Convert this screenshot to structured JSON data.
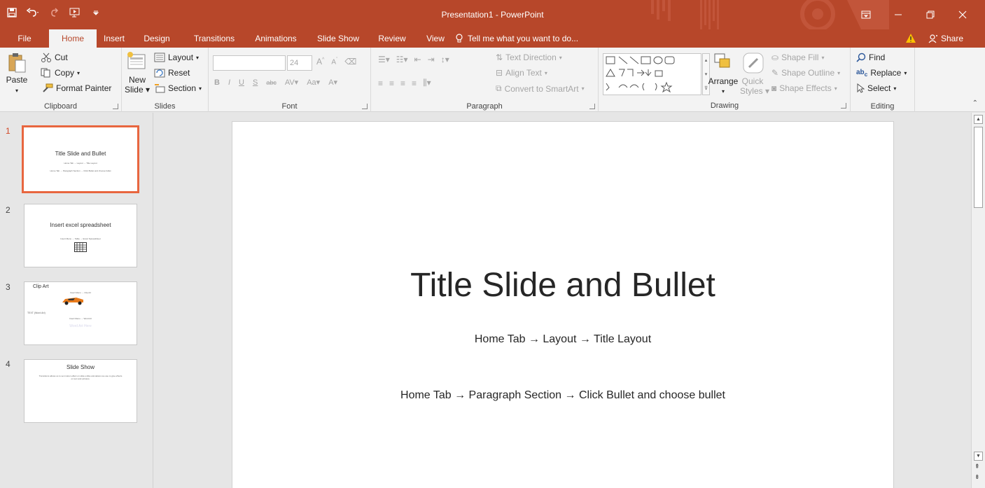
{
  "colors": {
    "accent": "#b7472a",
    "ribbon_bg": "#f3f3f3",
    "selected_thumb": "#e8663f"
  },
  "app": {
    "title": "Presentation1 - PowerPoint"
  },
  "quick_access": [
    "save-icon",
    "undo-icon",
    "redo-icon",
    "start-from-beginning-icon",
    "customize-qat-icon"
  ],
  "tabs": [
    {
      "label": "File"
    },
    {
      "label": "Home"
    },
    {
      "label": "Insert"
    },
    {
      "label": "Design"
    },
    {
      "label": "Transitions"
    },
    {
      "label": "Animations"
    },
    {
      "label": "Slide Show"
    },
    {
      "label": "Review"
    },
    {
      "label": "View"
    }
  ],
  "tell_me": "Tell me what you want to do...",
  "share": "Share",
  "ribbon": {
    "clipboard": {
      "paste": "Paste",
      "cut": "Cut",
      "copy": "Copy",
      "format_painter": "Format Painter",
      "label": "Clipboard"
    },
    "slides": {
      "new": "New",
      "slide": "Slide",
      "layout": "Layout",
      "reset": "Reset",
      "section": "Section",
      "label": "Slides"
    },
    "font": {
      "size": "24",
      "label": "Font"
    },
    "paragraph": {
      "text_direction": "Text Direction",
      "align_text": "Align Text",
      "convert_smartart": "Convert to SmartArt",
      "label": "Paragraph"
    },
    "drawing": {
      "arrange": "Arrange",
      "quick": "Quick",
      "styles": "Styles",
      "shape_fill": "Shape Fill",
      "shape_outline": "Shape Outline",
      "shape_effects": "Shape Effects",
      "label": "Drawing"
    },
    "editing": {
      "find": "Find",
      "replace": "Replace",
      "select": "Select",
      "label": "Editing"
    }
  },
  "slides": [
    {
      "num": "1",
      "title": "Title Slide and Bullet",
      "lines": [
        "Home Tab → Layout → Title Layout",
        "Home Tab → Paragraph Section → Click Bullet and choose bullet"
      ]
    },
    {
      "num": "2",
      "title": "Insert excel spreadsheet",
      "lines": [
        "Insert Menu → Table → Excel Spreadsheet"
      ]
    },
    {
      "num": "3",
      "title": "Clip Art",
      "lines": [
        "Insert Menu → Clip Art",
        "TEXT (Word Art)",
        "Insert Menu → Word Art",
        "Word Art Here"
      ]
    },
    {
      "num": "4",
      "title": "Slide Show",
      "lines": [
        "Transitions allows us to set motion effect on slide unlike animations we use to give effects on text and pictures."
      ]
    }
  ],
  "current_slide": {
    "title": "Title Slide and Bullet",
    "line1": "Home Tab → Layout → Title Layout",
    "line2": "Home Tab → Paragraph Section → Click Bullet and choose bullet"
  }
}
